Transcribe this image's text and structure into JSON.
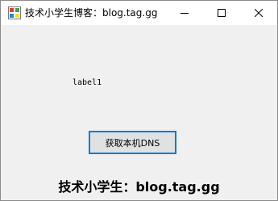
{
  "window": {
    "title": "技术小学生博客：blog.tag.gg",
    "app_icon": "winform-app-icon",
    "controls": {
      "minimize_icon": "minimize-icon",
      "maximize_icon": "maximize-icon",
      "close_icon": "close-icon"
    }
  },
  "form": {
    "label1_text": "label1",
    "dns_button_label": "获取本机DNS",
    "footer_text": "技术小学生：blog.tag.gg"
  },
  "colors": {
    "button_focus_border": "#0078d7",
    "form_background": "#f0f0f0",
    "button_background": "#e1e1e1"
  }
}
